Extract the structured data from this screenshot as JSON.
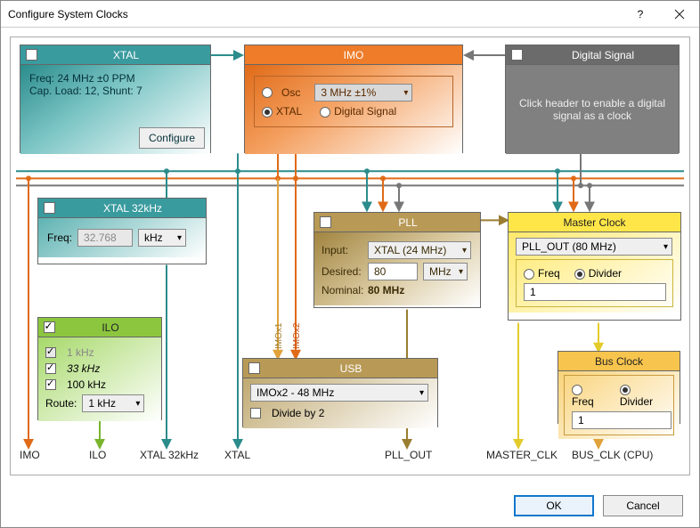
{
  "window": {
    "title": "Configure System Clocks"
  },
  "footer": {
    "ok": "OK",
    "cancel": "Cancel"
  },
  "xtal": {
    "title": "XTAL",
    "freq_line": "Freq: 24 MHz ±0 PPM",
    "cap_line": "Cap. Load: 12, Shunt: 7",
    "configure": "Configure"
  },
  "imo": {
    "title": "IMO",
    "osc": "Osc",
    "osc_select": "3 MHz  ±1%",
    "xtal": "XTAL",
    "dsig": "Digital Signal"
  },
  "dsig": {
    "title": "Digital Signal",
    "text": "Click header to enable a digital signal as a clock"
  },
  "x32": {
    "title": "XTAL 32kHz",
    "freq_label": "Freq:",
    "freq_value": "32.768",
    "unit_select": "kHz"
  },
  "ilo": {
    "title": "ILO",
    "opt1": "1 kHz",
    "opt2": "33 kHz",
    "opt3": "100 kHz",
    "route_label": "Route:",
    "route_value": "1 kHz"
  },
  "pll": {
    "title": "PLL",
    "input_label": "Input:",
    "input_value": "XTAL (24 MHz)",
    "desired_label": "Desired:",
    "desired_value": "80",
    "desired_unit": "MHz",
    "nominal_label": "Nominal:",
    "nominal_value": "80 MHz"
  },
  "usb": {
    "title": "USB",
    "select": "IMOx2 - 48 MHz",
    "div2": "Divide by 2"
  },
  "mclk": {
    "title": "Master Clock",
    "select": "PLL_OUT (80 MHz)",
    "freq": "Freq",
    "divider": "Divider",
    "value": "1"
  },
  "bclk": {
    "title": "Bus Clock",
    "freq": "Freq",
    "divider": "Divider",
    "value": "1"
  },
  "labels": {
    "imo_out": "IMO",
    "ilo_out": "ILO",
    "xtal32_out": "XTAL 32kHz",
    "xtal_out": "XTAL",
    "pll_out": "PLL_OUT",
    "master_out": "MASTER_CLK",
    "bus_out": "BUS_CLK (CPU)",
    "imox1": "IMOx1",
    "imox2": "IMOx2"
  }
}
